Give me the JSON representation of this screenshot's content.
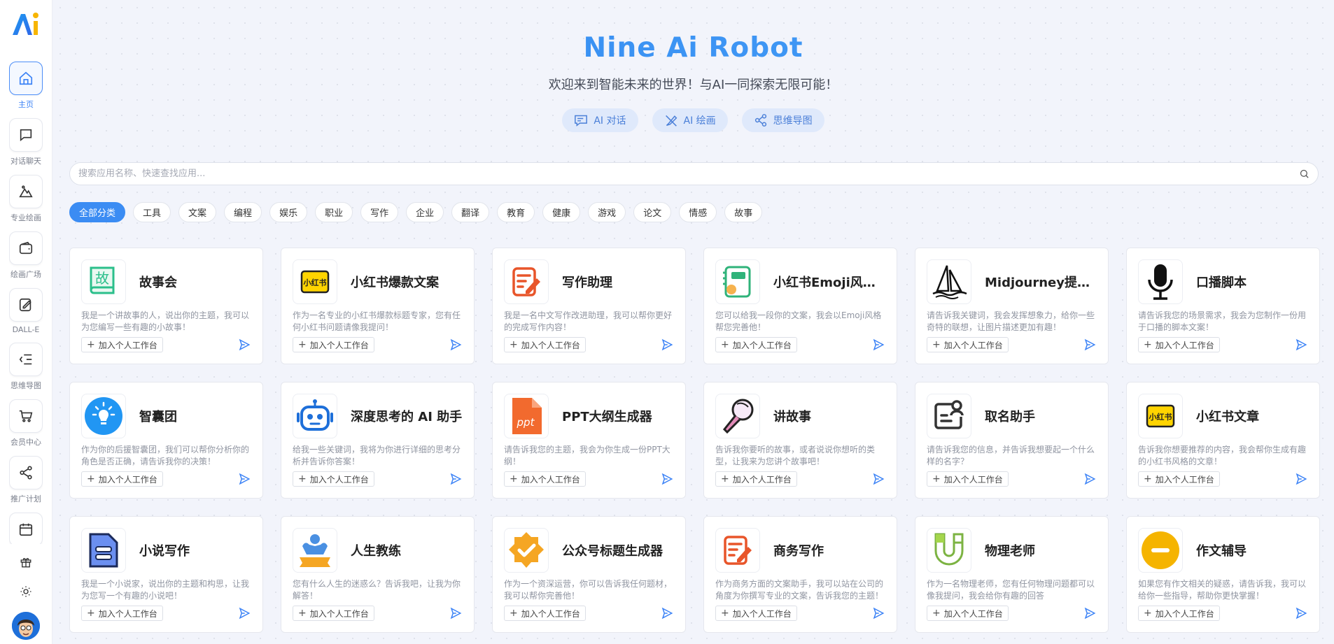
{
  "hero": {
    "title": "Nine Ai Robot",
    "subtitle": "欢迎来到智能未来的世界！与AI一同探索无限可能！",
    "quick_actions": [
      {
        "label": "AI 对话",
        "icon": "chat-icon"
      },
      {
        "label": "AI 绘画",
        "icon": "brush-icon"
      },
      {
        "label": "思维导图",
        "icon": "share-nodes-icon"
      }
    ]
  },
  "sidebar": {
    "items": [
      {
        "label": "主页",
        "icon": "home-icon",
        "active": true
      },
      {
        "label": "对话聊天",
        "icon": "chat-icon"
      },
      {
        "label": "专业绘画",
        "icon": "mountain-icon"
      },
      {
        "label": "绘画广场",
        "icon": "wallet-icon"
      },
      {
        "label": "DALL-E",
        "icon": "edit-picture-icon"
      },
      {
        "label": "思维导图",
        "icon": "list-tree-icon"
      },
      {
        "label": "会员中心",
        "icon": "cart-icon"
      },
      {
        "label": "推广计划",
        "icon": "share-icon"
      },
      {
        "label": "",
        "icon": "calendar-icon"
      }
    ],
    "bottom": [
      "gift-icon",
      "sun-icon",
      "avatar"
    ]
  },
  "search": {
    "placeholder": "搜索应用名称、快速查找应用..."
  },
  "categories": [
    "全部分类",
    "工具",
    "文案",
    "编程",
    "娱乐",
    "职业",
    "写作",
    "企业",
    "翻译",
    "教育",
    "健康",
    "游戏",
    "论文",
    "情感",
    "故事"
  ],
  "add_label": "加入个人工作台",
  "apps": [
    {
      "title": "故事会",
      "desc": "我是一个讲故事的人，说出你的主题，我可以为您编写一些有趣的小故事！",
      "icon": "book-icon"
    },
    {
      "title": "小红书爆款文案",
      "desc": "作为一名专业的小红书爆款标题专家，您有任何小红书问题请像我提问！",
      "icon": "xiaohongshu-icon"
    },
    {
      "title": "写作助理",
      "desc": "我是一名中文写作改进助理，我可以帮你更好的完成写作内容！",
      "icon": "note-pen-icon"
    },
    {
      "title": "小红书Emoji风格文案",
      "desc": "您可以给我一段你的文案，我会以Emoji风格帮您完善他！",
      "icon": "notebook-icon"
    },
    {
      "title": "Midjourney提示词生成",
      "desc": "请告诉我关键词，我会发挥想象力，给你一些奇特的联想，让图片描述更加有趣！",
      "icon": "sailboat-icon"
    },
    {
      "title": "口播脚本",
      "desc": "请告诉我您的场景需求，我会为您制作一份用于口播的脚本文案！",
      "icon": "microphone-icon"
    },
    {
      "title": "智囊团",
      "desc": "作为你的后援智囊团，我们可以帮你分析你的角色是否正确，请告诉我你的决策！",
      "icon": "lightbulb-icon"
    },
    {
      "title": "深度思考的 AI 助手",
      "desc": "给我一些关键词，我将为你进行详细的思考分析并告诉你答案！",
      "icon": "robot-icon"
    },
    {
      "title": "PPT大纲生成器",
      "desc": "请告诉我您的主题，我会为你生成一份PPT大纲！",
      "icon": "ppt-icon"
    },
    {
      "title": "讲故事",
      "desc": "告诉我你要听的故事，或者说说你想听的类型，让我来为您讲个故事吧！",
      "icon": "mic-ball-icon"
    },
    {
      "title": "取名助手",
      "desc": "请告诉我您的信息，并告诉我想要起一个什么样的名字？",
      "icon": "id-card-icon"
    },
    {
      "title": "小红书文章",
      "desc": "告诉我你想要推荐的内容，我会帮你生成有趣的小红书风格的文章！",
      "icon": "xiaohongshu-icon"
    },
    {
      "title": "小说写作",
      "desc": "我是一个小说家，说出你的主题和构思，让我为您写一个有趣的小说吧！",
      "icon": "document-icon"
    },
    {
      "title": "人生教练",
      "desc": "您有什么人生的迷惑么？告诉我吧，让我为你解答！",
      "icon": "muscle-icon"
    },
    {
      "title": "公众号标题生成器",
      "desc": "作为一个资深运营，你可以告诉我任何题材，我可以帮你完善他！",
      "icon": "badge-check-icon"
    },
    {
      "title": "商务写作",
      "desc": "作为商务方面的文案助手，我可以站在公司的角度为你撰写专业的文案，告诉我您的主题！",
      "icon": "note-pen-icon"
    },
    {
      "title": "物理老师",
      "desc": "作为一名物理老师，您有任何物理问题都可以像我提问，我会给你有趣的回答",
      "icon": "magnet-icon"
    },
    {
      "title": "作文辅导",
      "desc": "如果您有作文相关的疑惑，请告诉我，我可以给你一些指导，帮助你更快掌握！",
      "icon": "minus-circle-icon"
    }
  ],
  "colors": {
    "accent": "#3b8cf3",
    "title_gradient_start": "#2f86f0",
    "title_gradient_end": "#4aa2f7"
  }
}
